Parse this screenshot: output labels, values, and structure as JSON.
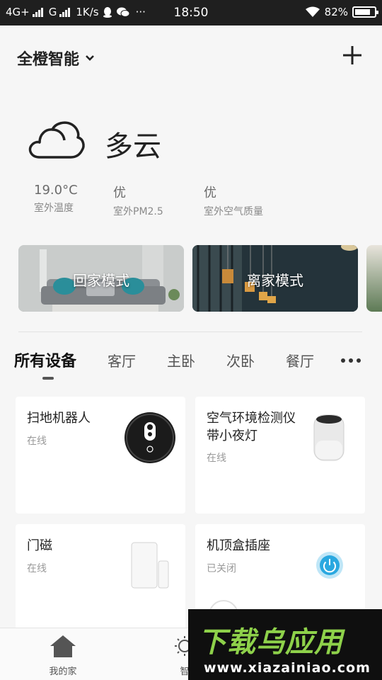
{
  "status_bar": {
    "network1": "4G+",
    "network2": "G",
    "speed": "1K/s",
    "more": "···",
    "time": "18:50",
    "battery": "82%",
    "battery_level": 0.82
  },
  "header": {
    "home_name": "全橙智能"
  },
  "weather": {
    "condition": "多云",
    "metrics": [
      {
        "value": "19.0°C",
        "label": "室外温度"
      },
      {
        "value": "优",
        "label": "室外PM2.5"
      },
      {
        "value": "优",
        "label": "室外空气质量"
      }
    ]
  },
  "scenes": [
    {
      "label": "回家模式"
    },
    {
      "label": "离家模式"
    }
  ],
  "tabs": [
    {
      "label": "所有设备"
    },
    {
      "label": "客厅"
    },
    {
      "label": "主卧"
    },
    {
      "label": "次卧"
    },
    {
      "label": "餐厅"
    }
  ],
  "devices": [
    {
      "name": "扫地机器人",
      "status": "在线"
    },
    {
      "name": "空气环境检测仪带小夜灯",
      "status": "在线"
    },
    {
      "name": "门磁",
      "status": "在线"
    },
    {
      "name": "机顶盒插座",
      "status": "已关闭"
    }
  ],
  "bottom_nav": [
    {
      "label": "我的家"
    },
    {
      "label": "智"
    }
  ],
  "watermark": {
    "title": "下载乌应用",
    "url": "www.xiazainiao.com"
  },
  "colors": {
    "accent_blue": "#2aa8e0",
    "watermark_green": "#8ed14a"
  }
}
